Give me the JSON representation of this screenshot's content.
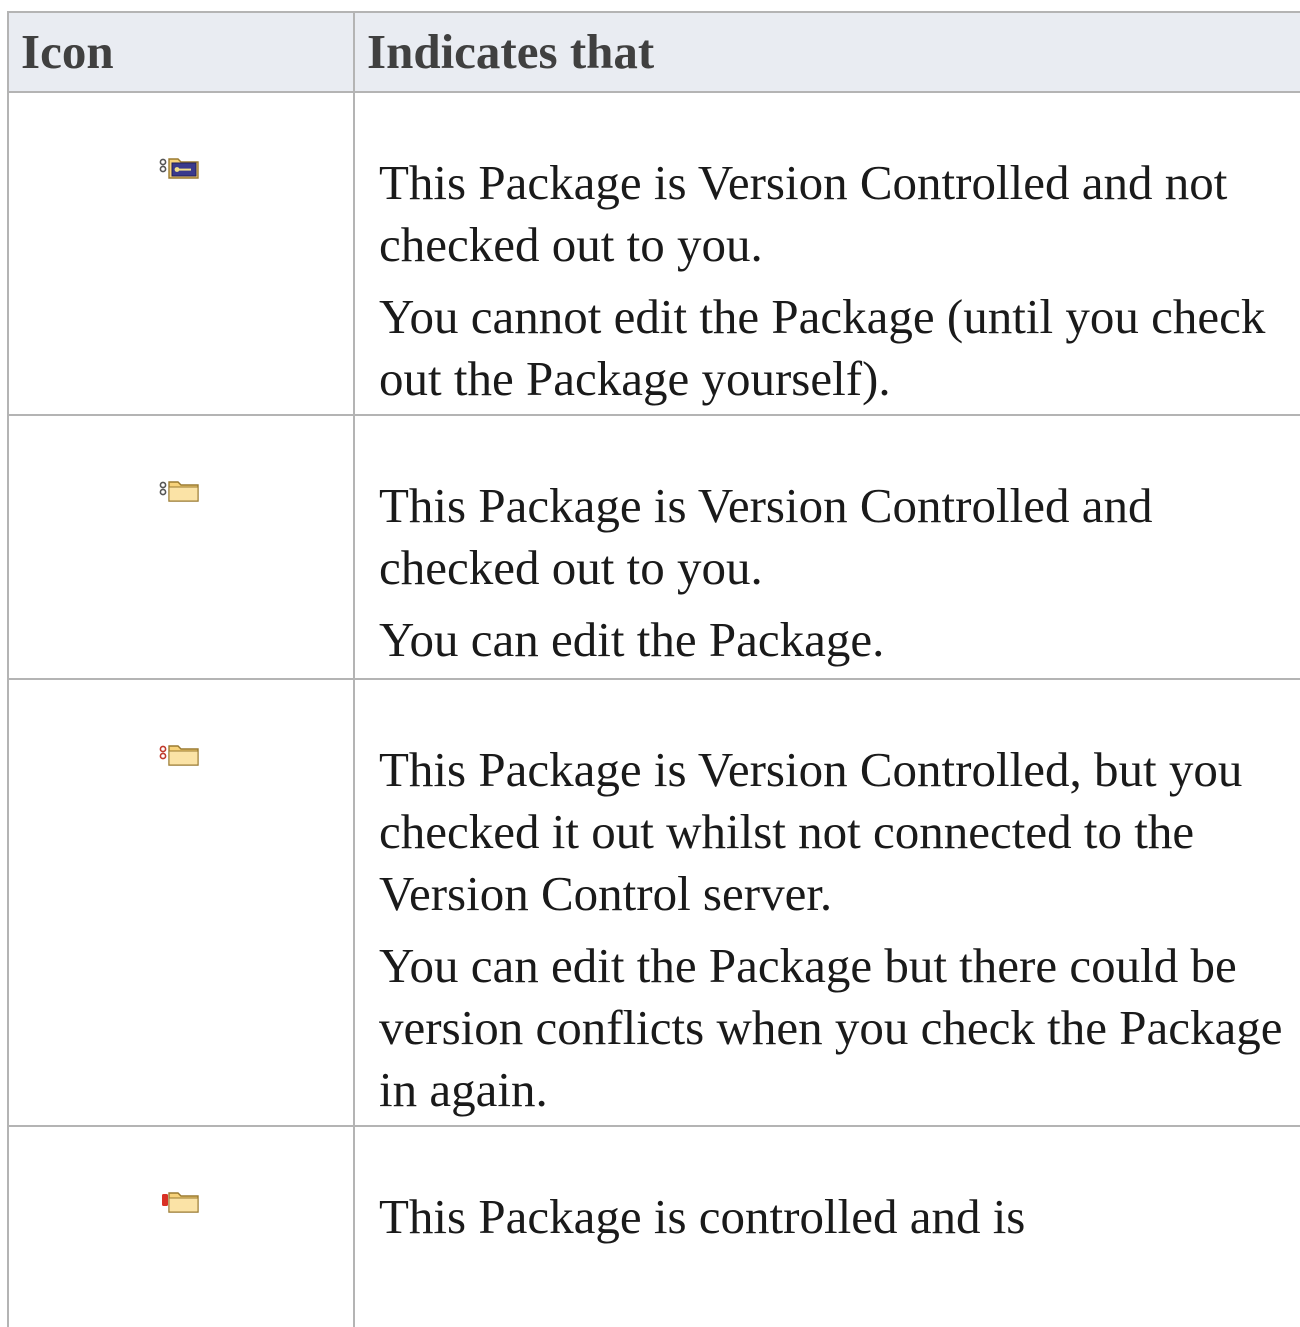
{
  "table": {
    "headers": {
      "icon": "Icon",
      "indicates": "Indicates that"
    },
    "rows": [
      {
        "icon": "version-controlled-locked-package-icon",
        "paragraphs": [
          "This Package is Version Controlled and not checked out to you.",
          "You cannot edit the Package (until you check out the Package yourself)."
        ]
      },
      {
        "icon": "version-controlled-checked-out-package-icon",
        "paragraphs": [
          "This Package is Version Controlled and checked out to you.",
          "You can edit the Package."
        ]
      },
      {
        "icon": "version-controlled-offline-checked-out-package-icon",
        "paragraphs": [
          "This Package is Version Controlled, but you checked it out whilst not connected to the Version Control server.",
          "You can edit the Package but there could be version conflicts when you check the Package in again."
        ]
      },
      {
        "icon": "controlled-package-icon",
        "paragraphs": [
          "This Package is controlled and is"
        ]
      }
    ]
  },
  "colors": {
    "header_bg": "#e9ecf2",
    "border": "#b4b4b4",
    "folder_fill": "#f7d27a",
    "locked_fill": "#3a3a8c"
  }
}
